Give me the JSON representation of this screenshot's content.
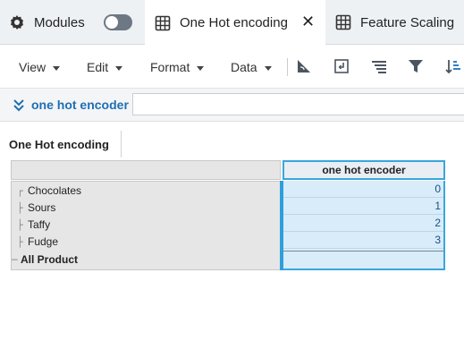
{
  "tabs": {
    "modules_label": "Modules",
    "active_label": "One Hot encoding",
    "next_label": "Feature Scaling"
  },
  "menubar": {
    "view": "View",
    "edit": "Edit",
    "format": "Format",
    "data": "Data"
  },
  "filter": {
    "label": "one hot encoder",
    "value": ""
  },
  "sheet": {
    "tab_label": "One Hot encoding"
  },
  "table": {
    "column_header": "one hot encoder",
    "rows": [
      {
        "label": "Chocolates",
        "value": "0"
      },
      {
        "label": "Sours",
        "value": "1"
      },
      {
        "label": "Taffy",
        "value": "2"
      },
      {
        "label": "Fudge",
        "value": "3"
      }
    ],
    "total_label": "All Product",
    "total_value": ""
  },
  "colors": {
    "accent": "#1f6fb2",
    "selection": "#3aa6dc",
    "cell_fill": "#d9ecf9"
  }
}
